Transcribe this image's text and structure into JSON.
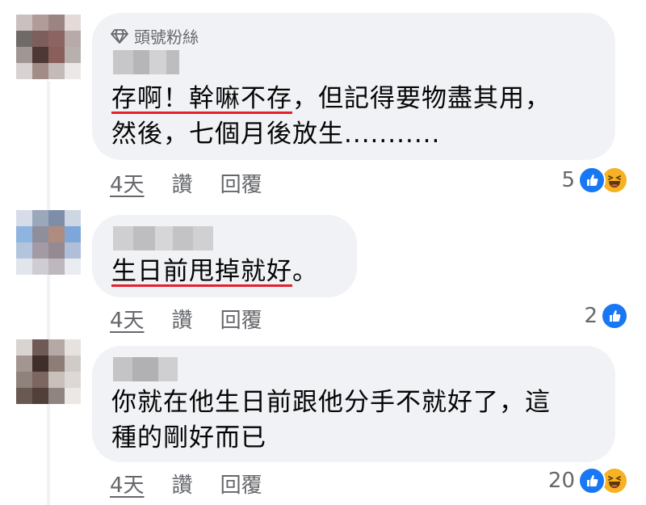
{
  "comments": [
    {
      "badge": "頭號粉絲",
      "line1_underlined": "存啊！幹嘛不存",
      "line1_rest": "，但記得要物盡其用，",
      "line2": "然後，七個月後放生...........",
      "time": "4天",
      "like_label": "讚",
      "reply_label": "回覆",
      "reaction_count": "5",
      "reaction_icons": [
        "like-icon",
        "haha-icon"
      ]
    },
    {
      "line1_underlined": "生日前甩掉就好",
      "line1_rest": "。",
      "time": "4天",
      "like_label": "讚",
      "reply_label": "回覆",
      "reaction_count": "2",
      "reaction_icons": [
        "like-icon"
      ]
    },
    {
      "line1": "你就在他生日前跟他分手不就好了，這",
      "line2": "種的剛好而已",
      "time": "4天",
      "like_label": "讚",
      "reply_label": "回覆",
      "reaction_count": "20",
      "reaction_icons": [
        "like-icon",
        "haha-icon"
      ]
    }
  ],
  "colors": {
    "bubble": "#f0f2f5",
    "muted_text": "#65676b",
    "underline_red": "#e4202c",
    "like_blue": "#1877f2",
    "haha_yellow": "#f7b125"
  }
}
